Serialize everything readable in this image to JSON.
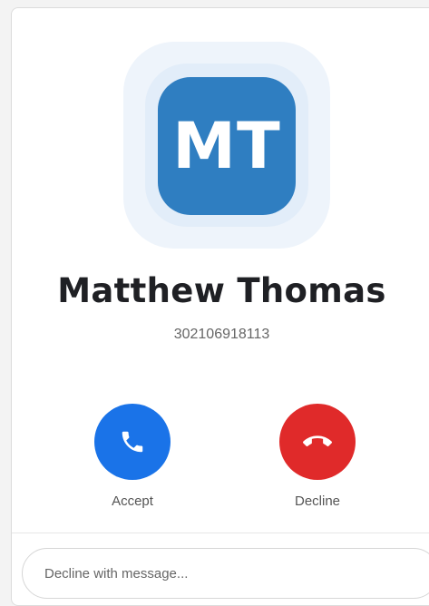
{
  "caller": {
    "initials": "MT",
    "name": "Matthew Thomas",
    "number": "302106918113"
  },
  "actions": {
    "accept_label": "Accept",
    "decline_label": "Decline",
    "accept_icon": "phone-icon",
    "decline_icon": "phone-hangup-icon"
  },
  "message": {
    "placeholder": "Decline with message..."
  },
  "colors": {
    "avatar": "#2f7ec1",
    "accept": "#1a73e8",
    "decline": "#e02a2a"
  }
}
